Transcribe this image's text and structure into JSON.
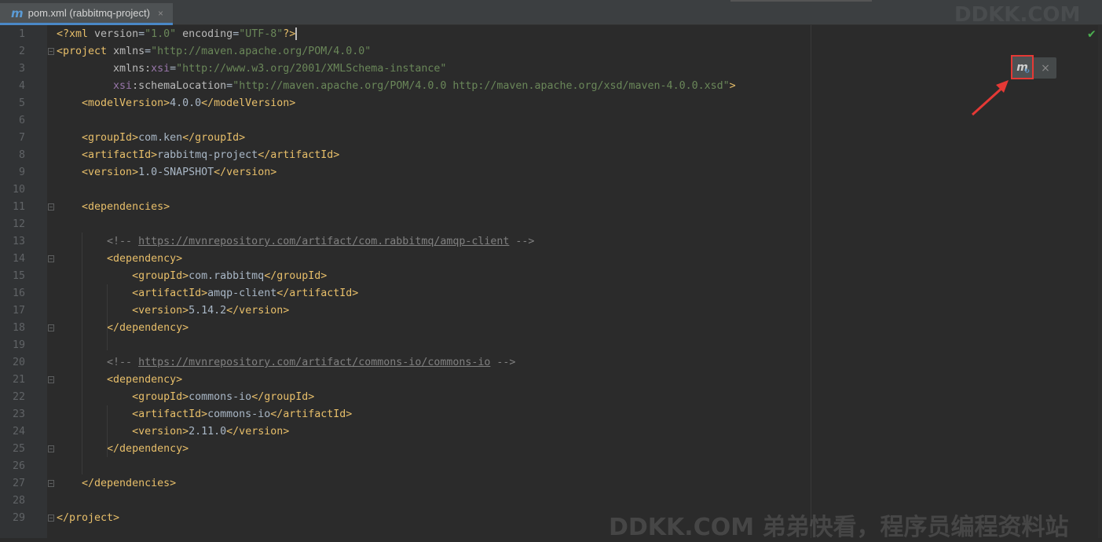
{
  "tab": {
    "icon": "m",
    "title": "pom.xml (rabbitmq-project)",
    "close": "×"
  },
  "maven_popup": {
    "icon_label": "m",
    "refresh_glyph": "↻",
    "close": "×"
  },
  "status": {
    "check": "✔"
  },
  "watermark": {
    "bottom": "DDKK.COM 弟弟快看，程序员编程资料站",
    "top": "DDKK.COM"
  },
  "colors": {
    "tag": "#e8bf6a",
    "value": "#6a8759",
    "namespace": "#9876aa",
    "comment": "#808080",
    "accent": "#4a88c7",
    "highlight": "#e53935"
  },
  "lines": [
    {
      "n": "1",
      "t": [
        [
          "tag",
          "<?xml "
        ],
        [
          "attr",
          "version"
        ],
        [
          "txt",
          "="
        ],
        [
          "val",
          "\"1.0\""
        ],
        [
          "attr",
          " encoding"
        ],
        [
          "txt",
          "="
        ],
        [
          "val",
          "\"UTF-8\""
        ],
        [
          "tag",
          "?>"
        ]
      ]
    },
    {
      "n": "2",
      "t": [
        [
          "tag",
          "<project "
        ],
        [
          "attr",
          "xmlns"
        ],
        [
          "txt",
          "="
        ],
        [
          "val",
          "\"http://maven.apache.org/POM/4.0.0\""
        ]
      ]
    },
    {
      "n": "3",
      "t": [
        [
          "attr",
          "         xmlns:"
        ],
        [
          "ns",
          "xsi"
        ],
        [
          "txt",
          "="
        ],
        [
          "val",
          "\"http://www.w3.org/2001/XMLSchema-instance\""
        ]
      ]
    },
    {
      "n": "4",
      "t": [
        [
          "ns",
          "         xsi"
        ],
        [
          "attr",
          ":schemaLocation"
        ],
        [
          "txt",
          "="
        ],
        [
          "val",
          "\"http://maven.apache.org/POM/4.0.0 http://maven.apache.org/xsd/maven-4.0.0.xsd\""
        ],
        [
          "tag",
          ">"
        ]
      ]
    },
    {
      "n": "5",
      "t": [
        [
          "tag",
          "    <modelVersion>"
        ],
        [
          "txt",
          "4.0.0"
        ],
        [
          "tag",
          "</modelVersion>"
        ]
      ]
    },
    {
      "n": "6",
      "t": []
    },
    {
      "n": "7",
      "t": [
        [
          "tag",
          "    <groupId>"
        ],
        [
          "txt",
          "com.ken"
        ],
        [
          "tag",
          "</groupId>"
        ]
      ]
    },
    {
      "n": "8",
      "t": [
        [
          "tag",
          "    <artifactId>"
        ],
        [
          "txt",
          "rabbitmq-project"
        ],
        [
          "tag",
          "</artifactId>"
        ]
      ]
    },
    {
      "n": "9",
      "t": [
        [
          "tag",
          "    <version>"
        ],
        [
          "txt",
          "1.0-SNAPSHOT"
        ],
        [
          "tag",
          "</version>"
        ]
      ]
    },
    {
      "n": "10",
      "t": []
    },
    {
      "n": "11",
      "t": [
        [
          "tag",
          "    <dependencies>"
        ]
      ]
    },
    {
      "n": "12",
      "t": []
    },
    {
      "n": "13",
      "t": [
        [
          "cmt",
          "        <!-- "
        ],
        [
          "url",
          "https://mvnrepository.com/artifact/com.rabbitmq/amqp-client"
        ],
        [
          "cmt",
          " -->"
        ]
      ]
    },
    {
      "n": "14",
      "t": [
        [
          "tag",
          "        <dependency>"
        ]
      ]
    },
    {
      "n": "15",
      "t": [
        [
          "tag",
          "            <groupId>"
        ],
        [
          "txt",
          "com.rabbitmq"
        ],
        [
          "tag",
          "</groupId>"
        ]
      ]
    },
    {
      "n": "16",
      "t": [
        [
          "tag",
          "            <artifactId>"
        ],
        [
          "txt",
          "amqp-client"
        ],
        [
          "tag",
          "</artifactId>"
        ]
      ]
    },
    {
      "n": "17",
      "t": [
        [
          "tag",
          "            <version>"
        ],
        [
          "txt",
          "5.14.2"
        ],
        [
          "tag",
          "</version>"
        ]
      ]
    },
    {
      "n": "18",
      "t": [
        [
          "tag",
          "        </dependency>"
        ]
      ]
    },
    {
      "n": "19",
      "t": []
    },
    {
      "n": "20",
      "t": [
        [
          "cmt",
          "        <!-- "
        ],
        [
          "url",
          "https://mvnrepository.com/artifact/commons-io/commons-io"
        ],
        [
          "cmt",
          " -->"
        ]
      ]
    },
    {
      "n": "21",
      "t": [
        [
          "tag",
          "        <dependency>"
        ]
      ]
    },
    {
      "n": "22",
      "t": [
        [
          "tag",
          "            <groupId>"
        ],
        [
          "txt",
          "commons-io"
        ],
        [
          "tag",
          "</groupId>"
        ]
      ]
    },
    {
      "n": "23",
      "t": [
        [
          "tag",
          "            <artifactId>"
        ],
        [
          "txt",
          "commons-io"
        ],
        [
          "tag",
          "</artifactId>"
        ]
      ]
    },
    {
      "n": "24",
      "t": [
        [
          "tag",
          "            <version>"
        ],
        [
          "txt",
          "2.11.0"
        ],
        [
          "tag",
          "</version>"
        ]
      ]
    },
    {
      "n": "25",
      "t": [
        [
          "tag",
          "        </dependency>"
        ]
      ]
    },
    {
      "n": "26",
      "t": []
    },
    {
      "n": "27",
      "t": [
        [
          "tag",
          "    </dependencies>"
        ]
      ]
    },
    {
      "n": "28",
      "t": []
    },
    {
      "n": "29",
      "t": [
        [
          "tag",
          "</project>"
        ]
      ]
    }
  ]
}
